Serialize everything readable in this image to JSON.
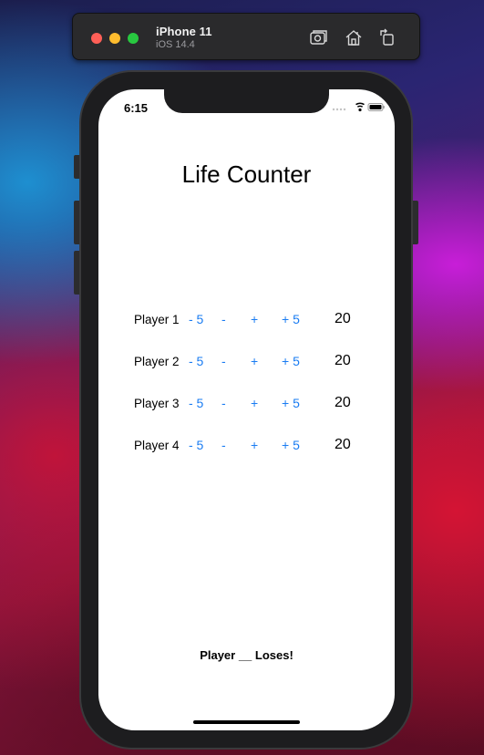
{
  "simulator": {
    "device_name": "iPhone 11",
    "os_version": "iOS 14.4",
    "toolbar_icons": [
      "camera-screenshot-icon",
      "home-icon",
      "rotate-icon"
    ]
  },
  "status_bar": {
    "time": "6:15",
    "icons": [
      "signal-icon",
      "wifi-icon",
      "battery-icon"
    ]
  },
  "app": {
    "title": "Life Counter",
    "players": [
      {
        "name": "Player 1",
        "minus5": "- 5",
        "minus1": "-",
        "plus1": "+",
        "plus5": "+ 5",
        "life": "20"
      },
      {
        "name": "Player 2",
        "minus5": "- 5",
        "minus1": "-",
        "plus1": "+",
        "plus5": "+ 5",
        "life": "20"
      },
      {
        "name": "Player 3",
        "minus5": "- 5",
        "minus1": "-",
        "plus1": "+",
        "plus5": "+ 5",
        "life": "20"
      },
      {
        "name": "Player 4",
        "minus5": "- 5",
        "minus1": "-",
        "plus1": "+",
        "plus5": "+ 5",
        "life": "20"
      }
    ],
    "loser_label": "Player __ Loses!"
  },
  "colors": {
    "button_tint": "#1a7cf2",
    "screen_background": "#ffffff",
    "device_frame": "#1d1d1f"
  }
}
